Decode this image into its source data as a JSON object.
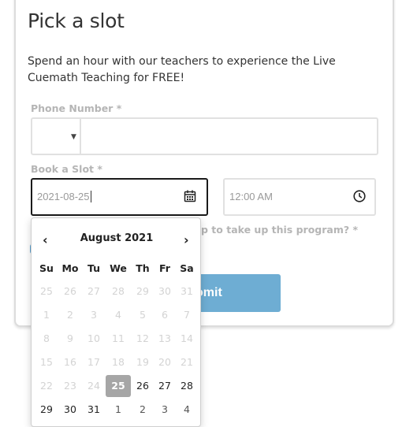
{
  "page": {
    "title": "Pick a slot",
    "description": "Spend an hour with our teachers to experience the Live Cuemath Teaching for FREE!"
  },
  "form": {
    "phone_label": "Phone Number *",
    "phone_value": "",
    "country_code_value": "",
    "slot_label": "Book a Slot *",
    "date_value": "2021-08-25",
    "time_value": "12:00 AM",
    "question_partial": "p to take up this program? *",
    "submit_partial": "omit"
  },
  "calendar": {
    "month_title": "August 2021",
    "prev_label": "‹",
    "next_label": "›",
    "weekdays": [
      "Su",
      "Mo",
      "Tu",
      "We",
      "Th",
      "Fr",
      "Sa"
    ],
    "weeks": [
      [
        "25",
        "26",
        "27",
        "28",
        "29",
        "30",
        "31"
      ],
      [
        "1",
        "2",
        "3",
        "4",
        "5",
        "6",
        "7"
      ],
      [
        "8",
        "9",
        "10",
        "11",
        "12",
        "13",
        "14"
      ],
      [
        "15",
        "16",
        "17",
        "18",
        "19",
        "20",
        "21"
      ],
      [
        "22",
        "23",
        "24",
        "25",
        "26",
        "27",
        "28"
      ],
      [
        "29",
        "30",
        "31",
        "1",
        "2",
        "3",
        "4"
      ]
    ],
    "selected_day": "25",
    "colors": {
      "selected_bg": "#a6a6a6",
      "muted": "#d3d3d3",
      "submit_bg": "#6eadd3"
    }
  }
}
